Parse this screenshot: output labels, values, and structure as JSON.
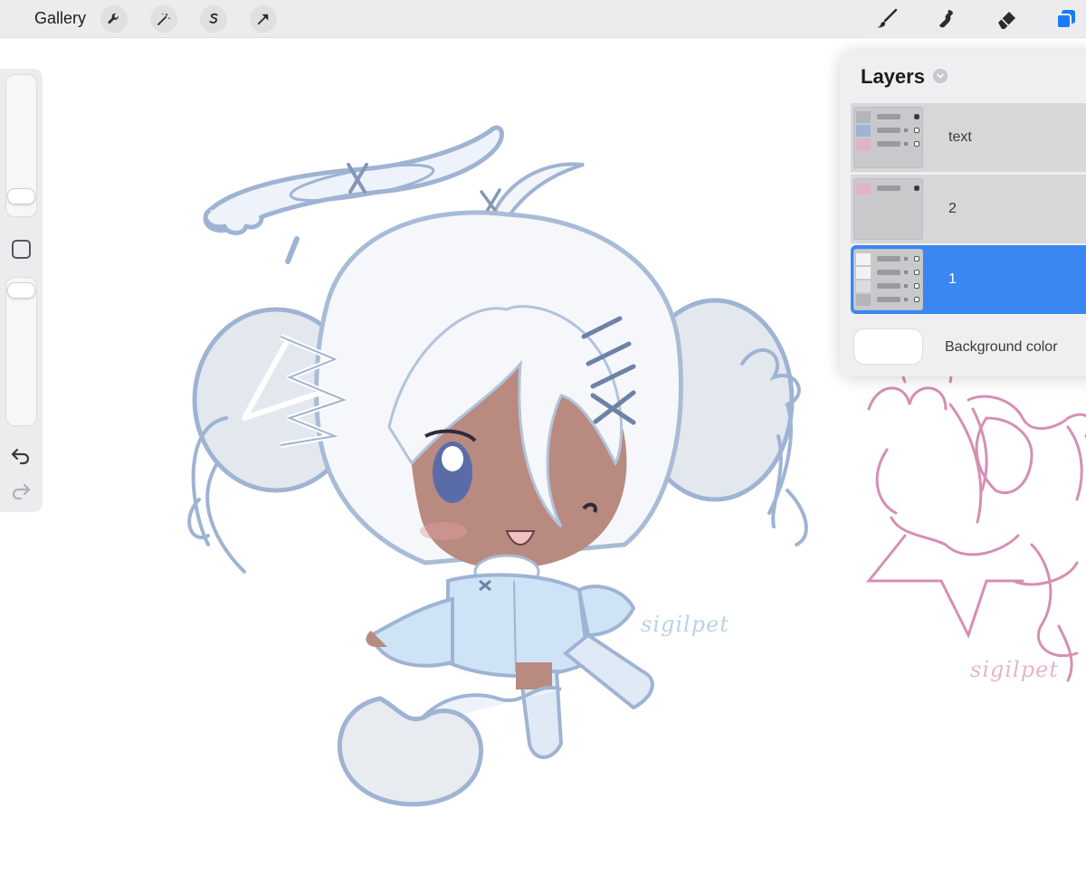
{
  "topbar": {
    "gallery_label": "Gallery",
    "left_tools": [
      "wrench-icon",
      "magic-wand-icon",
      "selection-s-icon",
      "transform-arrow-icon"
    ],
    "right_tools": [
      "brush-icon",
      "smudge-icon",
      "eraser-icon",
      "layers-icon"
    ],
    "accent_color": "#1a7cf5"
  },
  "sidebar": {
    "brush_size_level": 0.62,
    "opacity_level": 0.02,
    "tools": [
      "modify-square-icon",
      "undo-icon",
      "redo-icon"
    ]
  },
  "layers_panel": {
    "title": "Layers",
    "layers": [
      {
        "name": "text",
        "selected": false
      },
      {
        "name": "2",
        "selected": false
      },
      {
        "name": "1",
        "selected": true
      }
    ],
    "background_label": "Background color",
    "background_color": "#ffffff",
    "selected_color": "#3a87f2"
  },
  "canvas": {
    "watermark_blue": "sigilpet",
    "watermark_pink": "sigilpet",
    "line_blue": "#9fb3d3",
    "line_pink": "#d58fb4",
    "skin_color": "#b98a80",
    "outfit_color": "#cfe3f6"
  }
}
